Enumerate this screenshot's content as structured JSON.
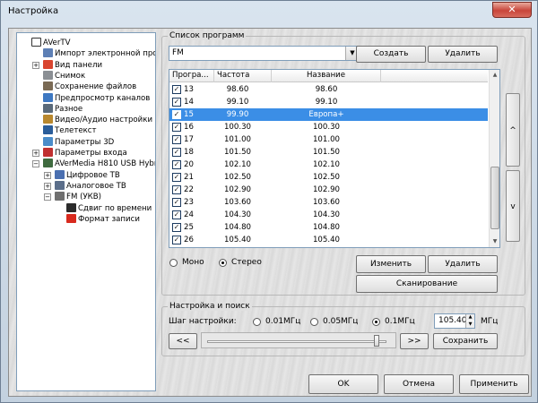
{
  "window": {
    "title": "Настройка",
    "close_glyph": "✕"
  },
  "tree": [
    {
      "label": "AVerTV",
      "icon": "checkbox-icon",
      "color": "#ffffff",
      "exp": "",
      "level": 0
    },
    {
      "label": "Импорт электронной прогр",
      "icon": "import-icon",
      "color": "#5d7fb5",
      "exp": "",
      "level": 1
    },
    {
      "label": "Вид панели",
      "icon": "panel-icon",
      "color": "#d9452f",
      "exp": "+",
      "level": 1
    },
    {
      "label": "Снимок",
      "icon": "camera-icon",
      "color": "#8b8f94",
      "exp": "",
      "level": 1
    },
    {
      "label": "Сохранение файлов",
      "icon": "save-icon",
      "color": "#7a6a55",
      "exp": "",
      "level": 1
    },
    {
      "label": "Предпросмотр каналов",
      "icon": "eye-icon",
      "color": "#3e78c2",
      "exp": "",
      "level": 1
    },
    {
      "label": "Разное",
      "icon": "wrench-icon",
      "color": "#5a6a7a",
      "exp": "",
      "level": 1
    },
    {
      "label": "Видео/Аудио настройки",
      "icon": "settings-icon",
      "color": "#b9882e",
      "exp": "",
      "level": 1
    },
    {
      "label": "Телетекст",
      "icon": "teletext-icon",
      "color": "#2a5d9a",
      "exp": "",
      "level": 1
    },
    {
      "label": "Параметры 3D",
      "icon": "gear-icon",
      "color": "#4a8cc9",
      "exp": "",
      "level": 1
    },
    {
      "label": "Параметры входа",
      "icon": "input-icon",
      "color": "#c03030",
      "exp": "+",
      "level": 1
    },
    {
      "label": "AVerMedia H810 USB Hybri",
      "icon": "device-icon",
      "color": "#3f6b3f",
      "exp": "−",
      "level": 1
    },
    {
      "label": "Цифровое ТВ",
      "icon": "tv-icon",
      "color": "#4a6fb0",
      "exp": "+",
      "level": 2
    },
    {
      "label": "Аналоговое ТВ",
      "icon": "tv-icon",
      "color": "#5b6e8a",
      "exp": "+",
      "level": 2
    },
    {
      "label": "FM (УКВ)",
      "icon": "radio-icon",
      "color": "#6f6f6f",
      "exp": "−",
      "level": 2
    },
    {
      "label": "Сдвиг по времени",
      "icon": "timeshift-icon",
      "color": "#2b2b2b",
      "exp": "",
      "level": 3
    },
    {
      "label": "Формат записи",
      "icon": "record-icon",
      "color": "#d82a1e",
      "exp": "",
      "level": 3
    }
  ],
  "programs": {
    "group_label": "Список программ",
    "band_value": "FM",
    "create_button": "Создать",
    "delete_button": "Удалить",
    "columns": [
      "Програ...",
      "Частота",
      "Название"
    ],
    "rows": [
      {
        "num": "13",
        "freq": "98.60",
        "name": "98.60",
        "checked": true,
        "selected": false
      },
      {
        "num": "14",
        "freq": "99.10",
        "name": "99.10",
        "checked": true,
        "selected": false
      },
      {
        "num": "15",
        "freq": "99.90",
        "name": "Европа+",
        "checked": true,
        "selected": true
      },
      {
        "num": "16",
        "freq": "100.30",
        "name": "100.30",
        "checked": true,
        "selected": false
      },
      {
        "num": "17",
        "freq": "101.00",
        "name": "101.00",
        "checked": true,
        "selected": false
      },
      {
        "num": "18",
        "freq": "101.50",
        "name": "101.50",
        "checked": true,
        "selected": false
      },
      {
        "num": "20",
        "freq": "102.10",
        "name": "102.10",
        "checked": true,
        "selected": false
      },
      {
        "num": "21",
        "freq": "102.50",
        "name": "102.50",
        "checked": true,
        "selected": false
      },
      {
        "num": "22",
        "freq": "102.90",
        "name": "102.90",
        "checked": true,
        "selected": false
      },
      {
        "num": "23",
        "freq": "103.60",
        "name": "103.60",
        "checked": true,
        "selected": false
      },
      {
        "num": "24",
        "freq": "104.30",
        "name": "104.30",
        "checked": true,
        "selected": false
      },
      {
        "num": "25",
        "freq": "104.80",
        "name": "104.80",
        "checked": true,
        "selected": false
      },
      {
        "num": "26",
        "freq": "105.40",
        "name": "105.40",
        "checked": true,
        "selected": false
      }
    ],
    "check_glyph": "✓",
    "scroll_up_glyph": "▲",
    "scroll_down_glyph": "▼",
    "move_up_glyph": "^",
    "move_down_glyph": "v",
    "mono_label": "Моно",
    "stereo_label": "Стерео",
    "edit_button": "Изменить",
    "delete2_button": "Удалить",
    "scan_button": "Сканирование"
  },
  "tuning": {
    "group_label": "Настройка и поиск",
    "step_label": "Шаг настройки:",
    "step_options": [
      "0.01МГц",
      "0.05МГц",
      "0.1МГц"
    ],
    "step_selected": 2,
    "freq_value": "105.40",
    "freq_unit": "МГц",
    "prev_button": "<<",
    "next_button": ">>",
    "save_button": "Сохранить",
    "slider_level": 0.93
  },
  "footer": {
    "ok": "OK",
    "cancel": "Отмена",
    "apply": "Применить"
  }
}
